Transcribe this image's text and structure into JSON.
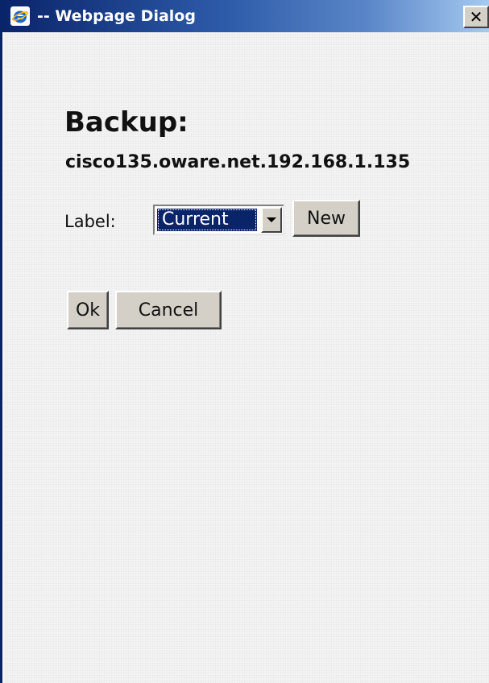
{
  "window": {
    "title": "-- Webpage Dialog",
    "title_icon": "internet-explorer-icon",
    "close_glyph": "✕",
    "close_icon": "close-icon"
  },
  "dialog": {
    "heading": "Backup:",
    "hostname": "cisco135.oware.net.192.168.1.135",
    "label_caption": "Label:",
    "label_select": {
      "selected": "Current"
    },
    "new_button": "New",
    "ok_button": "Ok",
    "cancel_button": "Cancel"
  },
  "colors": {
    "titlebar_start": "#0a246a",
    "titlebar_end": "#a6caf0",
    "button_face": "#d4d0c8",
    "selection": "#0a246a"
  }
}
